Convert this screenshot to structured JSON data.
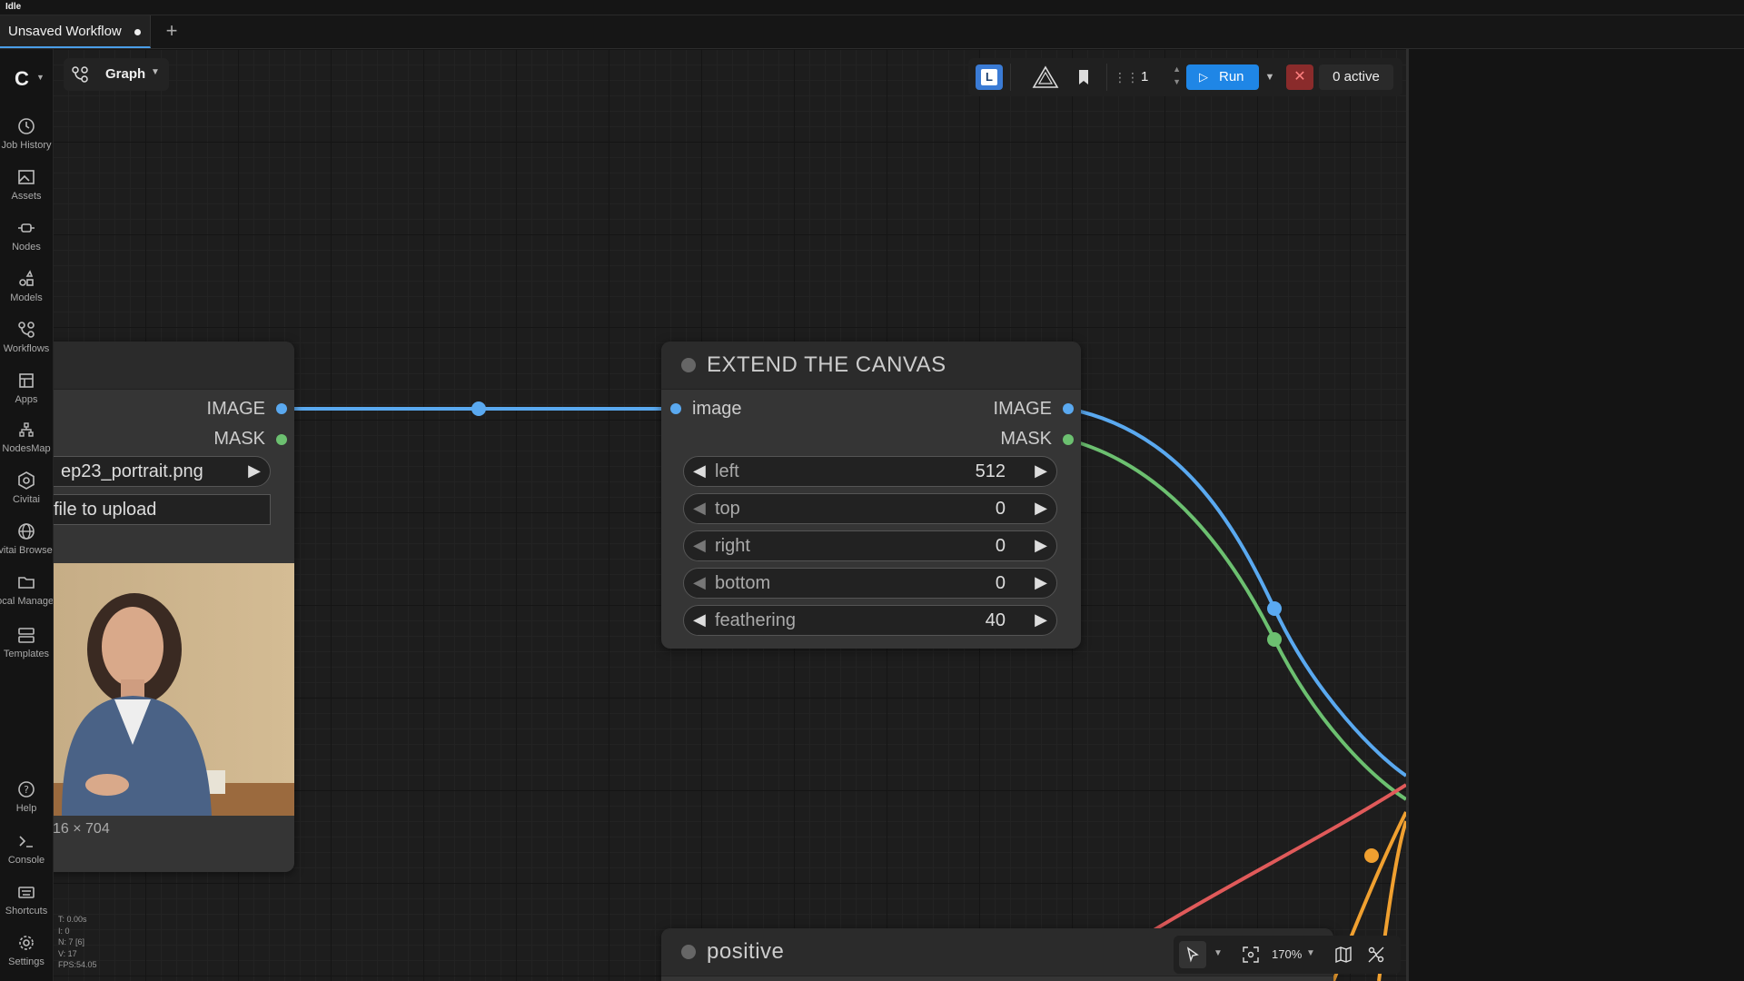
{
  "window": {
    "status": "Idle"
  },
  "tabs": [
    {
      "label": "Unsaved Workflow"
    }
  ],
  "sidebar": {
    "items": [
      {
        "label": "Job History",
        "icon": "history-icon"
      },
      {
        "label": "Assets",
        "icon": "image-icon"
      },
      {
        "label": "Nodes",
        "icon": "node-icon"
      },
      {
        "label": "Models",
        "icon": "models-icon"
      },
      {
        "label": "Workflows",
        "icon": "workflow-icon"
      },
      {
        "label": "Apps",
        "icon": "apps-icon"
      },
      {
        "label": "NodesMap",
        "icon": "nodesmap-icon"
      },
      {
        "label": "Civitai",
        "icon": "civitai-icon"
      },
      {
        "label": "Civitai Browser",
        "icon": "globe-icon"
      },
      {
        "label": "Local Manager",
        "icon": "folder-icon"
      },
      {
        "label": "Templates",
        "icon": "templates-icon"
      }
    ],
    "bottom_items": [
      {
        "label": "Help",
        "icon": "help-icon"
      },
      {
        "label": "Console",
        "icon": "console-icon"
      },
      {
        "label": "Shortcuts",
        "icon": "keyboard-icon"
      },
      {
        "label": "Settings",
        "icon": "gear-icon"
      }
    ]
  },
  "graph_button": {
    "label": "Graph"
  },
  "toolbar": {
    "l_button": "L",
    "queue_count": "1",
    "run_label": "Run",
    "cancel_label": "✕",
    "active_label": "0 active"
  },
  "load_image_node": {
    "outputs": [
      "IMAGE",
      "MASK"
    ],
    "image_select": "ep23_portrait.png",
    "upload_label": "file to upload",
    "dimensions": "16 × 704"
  },
  "extend_node": {
    "title": "EXTEND THE CANVAS",
    "input": "image",
    "outputs": [
      "IMAGE",
      "MASK"
    ],
    "widgets": [
      {
        "name": "left",
        "value": "512"
      },
      {
        "name": "top",
        "value": "0"
      },
      {
        "name": "right",
        "value": "0"
      },
      {
        "name": "bottom",
        "value": "0"
      },
      {
        "name": "feathering",
        "value": "40"
      }
    ]
  },
  "positive_node": {
    "title": "positive"
  },
  "stats": {
    "t": "T: 0.00s",
    "i": "I: 0",
    "n": "N: 7 [6]",
    "v": "V: 17",
    "fps": "FPS:54.05"
  },
  "bottom_toolbar": {
    "zoom": "170%"
  },
  "colors": {
    "image_link": "#5aa9f0",
    "mask_link": "#6cc070",
    "red_link": "#e05a5a",
    "orange_link": "#f0a030",
    "accent": "#1f86e6"
  }
}
